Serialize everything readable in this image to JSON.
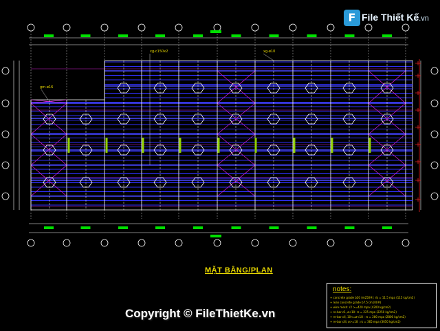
{
  "watermark": {
    "brand": "File Thiết Kế",
    "tld": ".vn",
    "copyright": "Copyright © FileThietKe.vn"
  },
  "drawing": {
    "title": "MẶT BẰNG/PLAN",
    "annotations": [
      "xg-c150x2",
      "xg-ø10",
      "gm-ø16"
    ],
    "colors": {
      "background": "#000000",
      "purlin": "#3030ff",
      "bracing": "#d020d0",
      "grid": "#ffffff",
      "dimension": "#00e000",
      "text": "#e8d800",
      "axis_red": "#e02020"
    }
  },
  "notes": {
    "heading": "notes:",
    "items": [
      "concrete grade b20 (m250#): rb = 11.5 mpa (115 kg/cm2)",
      "lean concrete grade b7.5 (m100#)",
      "wire mesh: r2 >=420 mpa (4200 kg/cm2)",
      "re-bar c1, ø<10: rs = 225 mpa (2250 kg/cm2)",
      "re-bar cII, 10<=ø<18 : rs = 280 mpa (2800 kg/cm2)",
      "re-bar cIII, ø>=18 : rs = 365 mpa (3650 kg/cm2)"
    ]
  }
}
